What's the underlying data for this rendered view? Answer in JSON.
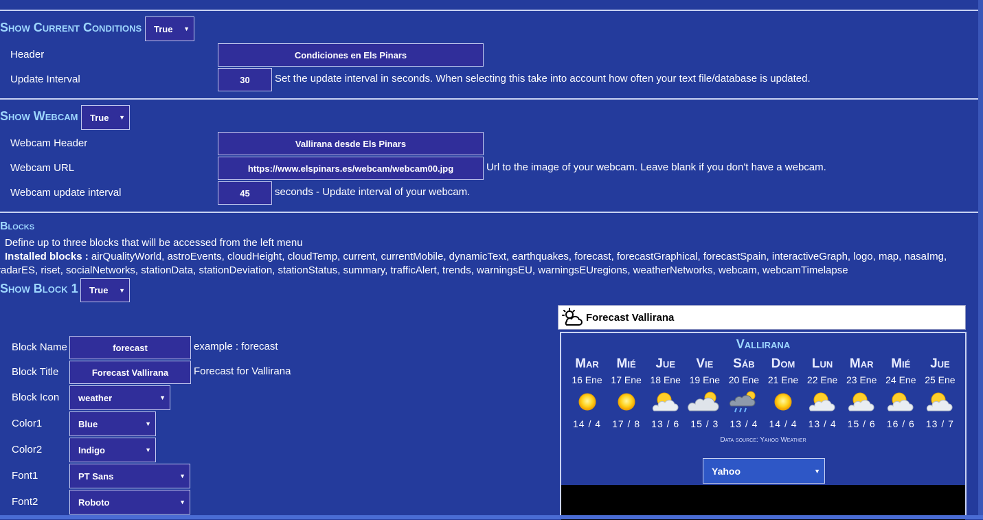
{
  "current": {
    "title": "Show Current Conditions",
    "show_value": "True",
    "header_label": "Header",
    "header_value": "Condiciones en Els Pinars",
    "interval_label": "Update Interval",
    "interval_value": "30",
    "interval_hint": "Set the update interval in seconds. When selecting this take into account how often your text file/database is updated."
  },
  "webcam": {
    "title": "Show Webcam",
    "show_value": "True",
    "header_label": "Webcam Header",
    "header_value": "Vallirana desde Els Pinars",
    "url_label": "Webcam URL",
    "url_value": "https://www.elspinars.es/webcam/webcam00.jpg",
    "url_hint": "Url to the image of your webcam. Leave blank if you don't have a webcam.",
    "interval_label": "Webcam update interval",
    "interval_value": "45",
    "interval_hint": "seconds - Update interval of your webcam."
  },
  "blocks": {
    "title": "Blocks",
    "description": "Define up to three blocks that will be accessed from the left menu",
    "installed_label": "Installed blocks :",
    "installed_line1": " airQualityWorld, astroEvents, cloudHeight, cloudTemp, current, currentMobile, dynamicText, earthquakes, forecast, forecastGraphical, forecastSpain, interactiveGraph, logo, map, nasaImg,",
    "installed_line2": "radarES, riset, socialNetworks, stationData, stationDeviation, stationStatus, summary, trafficAlert, trends, warningsEU, warningsEUregions, weatherNetworks, webcam, webcamTimelapse"
  },
  "block1": {
    "title": "Show Block 1",
    "show_value": "True",
    "name_label": "Block Name",
    "name_value": "forecast",
    "name_hint": "example : forecast",
    "btitle_label": "Block Title",
    "btitle_value": "Forecast Vallirana",
    "btitle_hint": "Forecast for Vallirana",
    "icon_label": "Block Icon",
    "icon_value": "weather",
    "color1_label": "Color1",
    "color1_value": "Blue",
    "color2_label": "Color2",
    "color2_value": "Indigo",
    "font1_label": "Font1",
    "font1_value": "PT Sans",
    "font2_label": "Font2",
    "font2_value": "Roboto"
  },
  "forecast_widget": {
    "header": "Forecast Vallirana",
    "header_icon": "cloud-sun-icon",
    "city": "Vallirana",
    "days": [
      {
        "name": "Mar",
        "date": "16 Ene",
        "temp": "14 / 4",
        "icon": "sun-icon"
      },
      {
        "name": "Mié",
        "date": "17 Ene",
        "temp": "17 / 8",
        "icon": "sun-icon"
      },
      {
        "name": "Jue",
        "date": "18 Ene",
        "temp": "13 / 6",
        "icon": "sun-cloud-icon"
      },
      {
        "name": "Vie",
        "date": "19 Ene",
        "temp": "15 / 3",
        "icon": "cloud-sun-icon"
      },
      {
        "name": "Sáb",
        "date": "20 Ene",
        "temp": "13 / 4",
        "icon": "rain-cloud-icon"
      },
      {
        "name": "Dom",
        "date": "21 Ene",
        "temp": "14 / 4",
        "icon": "sun-icon"
      },
      {
        "name": "Lun",
        "date": "22 Ene",
        "temp": "13 / 4",
        "icon": "sun-cloud-icon"
      },
      {
        "name": "Mar",
        "date": "23 Ene",
        "temp": "15 / 6",
        "icon": "sun-cloud-icon"
      },
      {
        "name": "Mié",
        "date": "24 Ene",
        "temp": "16 / 6",
        "icon": "sun-cloud-icon"
      },
      {
        "name": "Jue",
        "date": "25 Ene",
        "temp": "13 / 7",
        "icon": "sun-cloud-icon"
      }
    ],
    "source": "Data source: Yahoo Weather",
    "provider_value": "Yahoo"
  },
  "colors": {
    "background": "#243b9c",
    "field": "#302e9a",
    "title": "#9ed7ff"
  }
}
